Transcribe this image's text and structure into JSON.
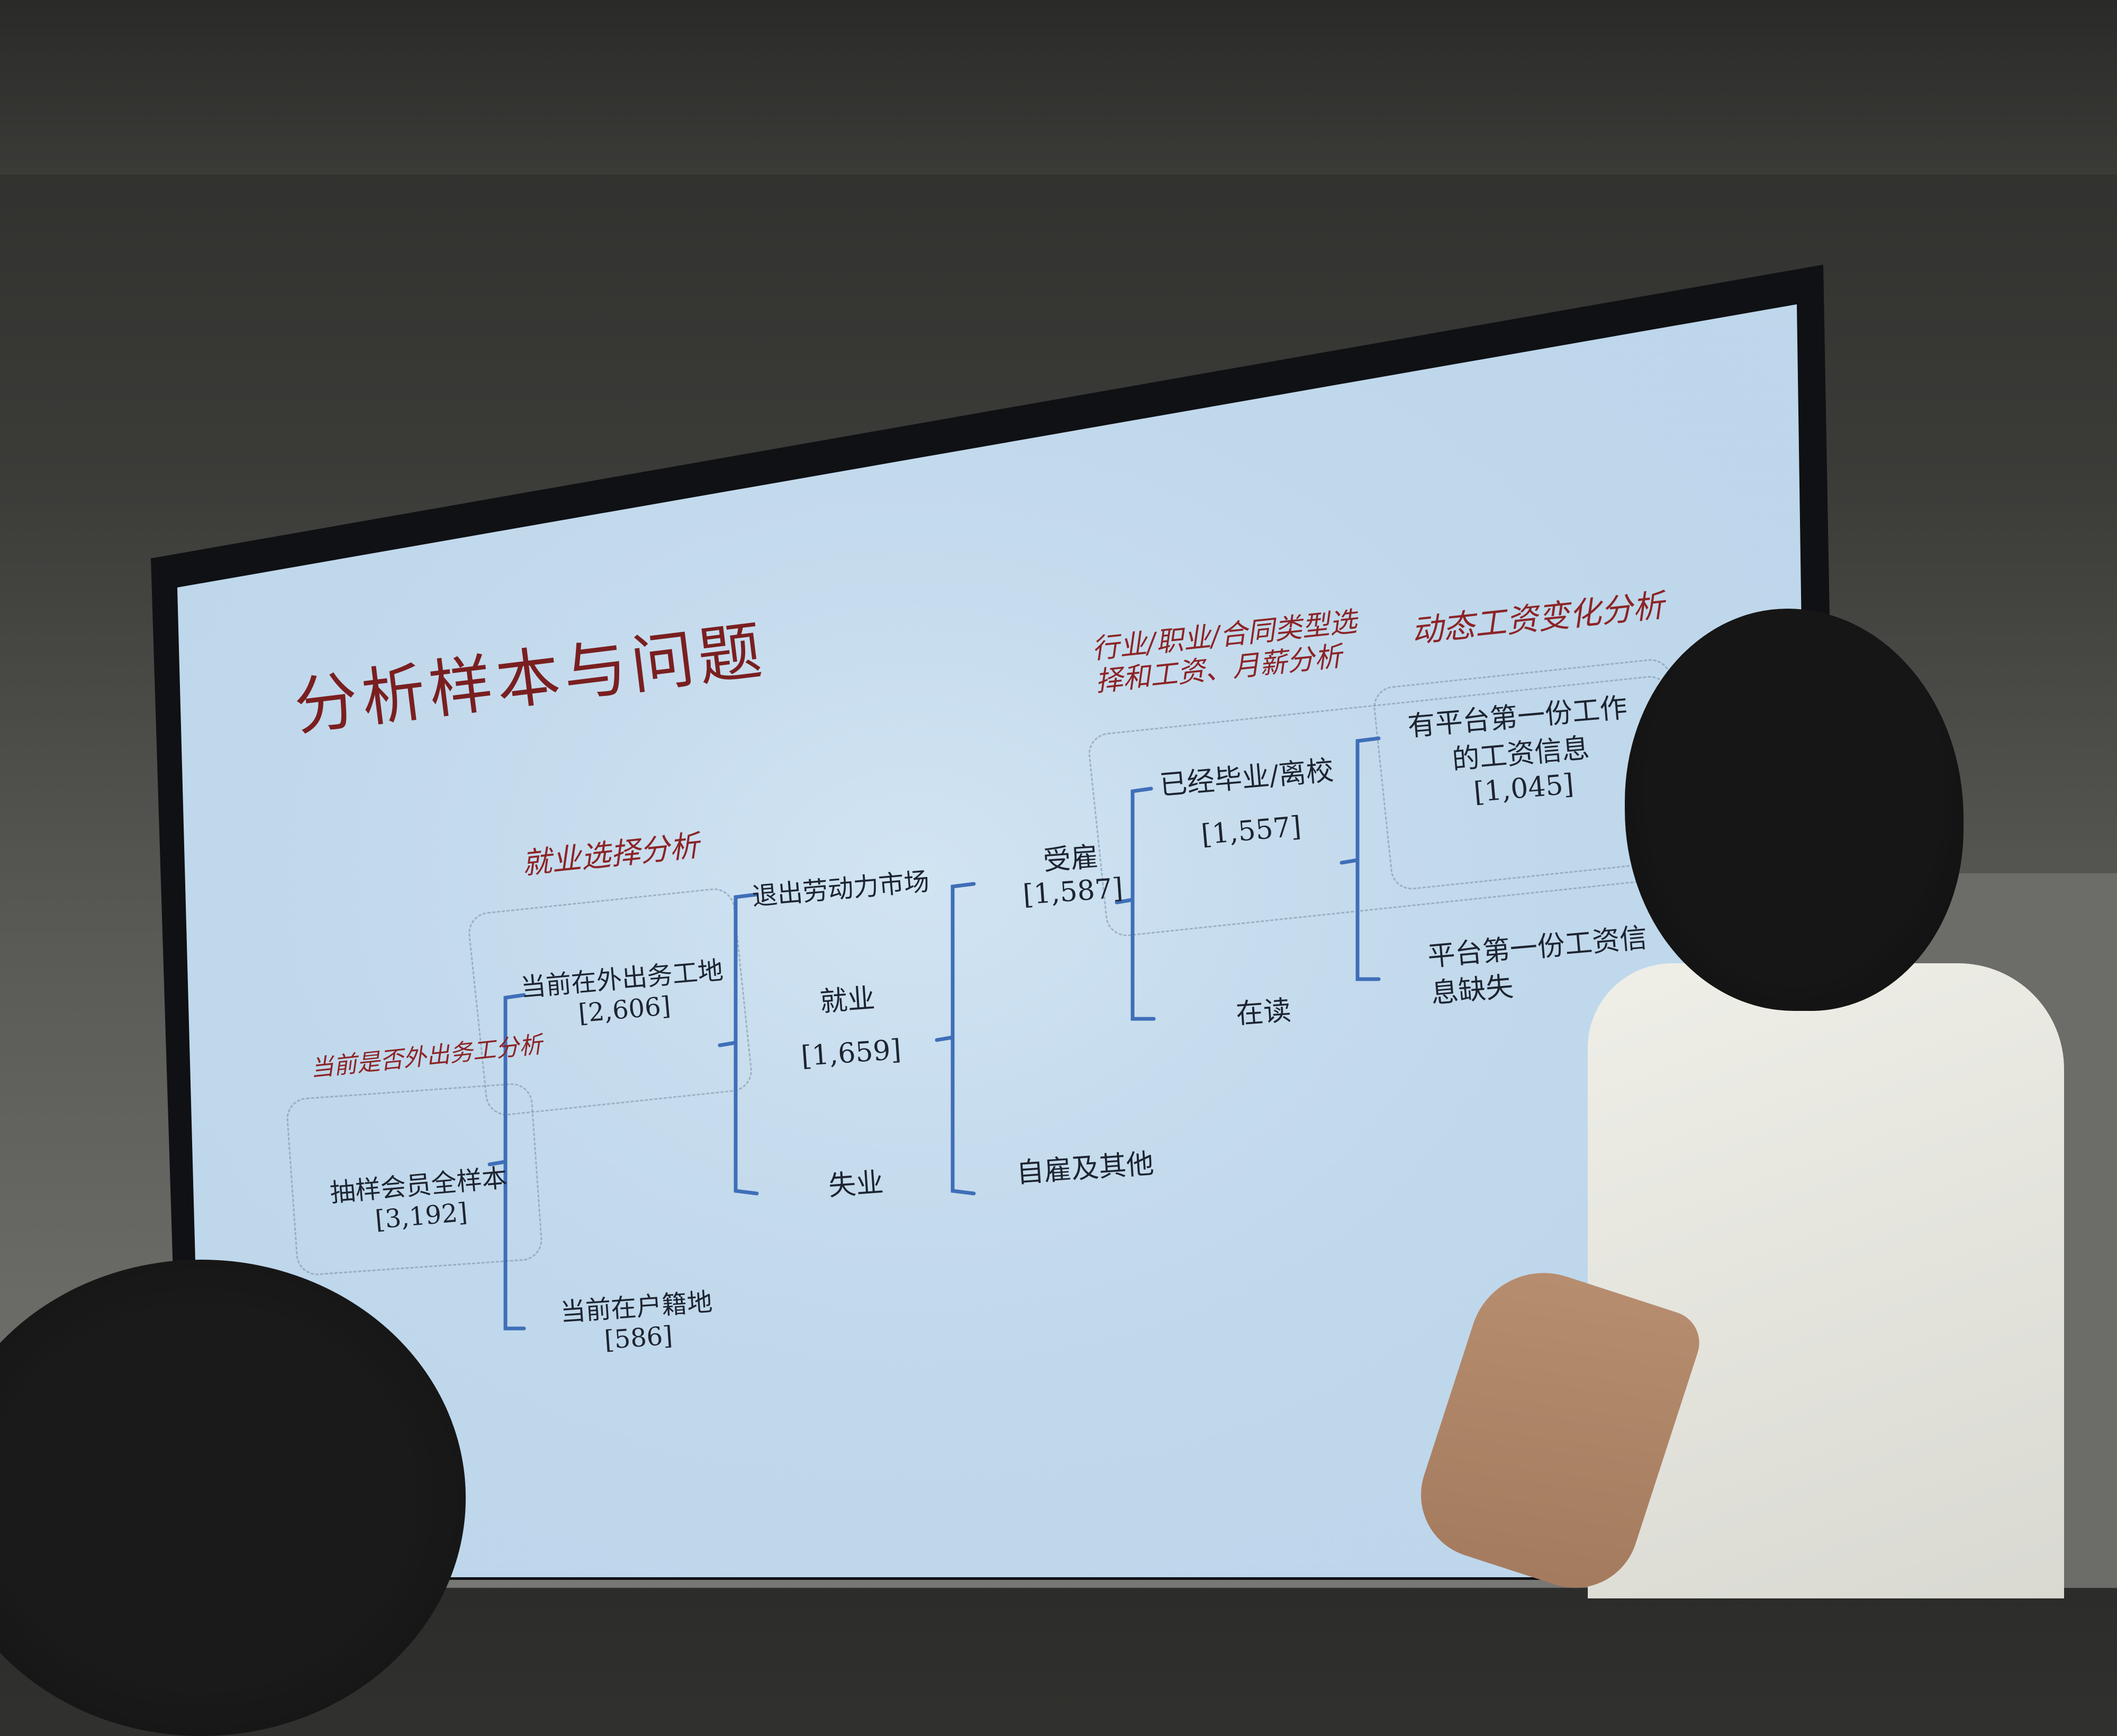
{
  "slide": {
    "title": "分析样本与问题",
    "section_labels": {
      "employment_choice": "就业选择分析",
      "migrant_work": "当前是否外出务工分析",
      "industry_occupation": "行业/职业/合同类型选\n择和工资、月薪分析",
      "dynamic_wage": "动态工资变化分析"
    },
    "nodes": {
      "full_sample": "抽样会员全样本",
      "full_sample_n": "[3,192]",
      "migrant": "当前在外出务工地",
      "migrant_n": "[2,606]",
      "hometown": "当前在户籍地",
      "hometown_n": "[586]",
      "exit_labor": "退出劳动力市场",
      "employed": "就业",
      "employed_n": "[1,659]",
      "unemployed": "失业",
      "hired": "受雇",
      "hired_n": "[1,587]",
      "self_employed": "自雇及其他",
      "graduated": "已经毕业/离校",
      "graduated_n": "[1,557]",
      "in_school": "在读",
      "has_wage": "有平台第一份工作\n的工资信息",
      "has_wage_n": "[1,045]",
      "missing_wage": "平台第一份工资信\n息缺失"
    }
  },
  "colors": {
    "screen_bg": "#bfd8ec",
    "bracket": "#3f6fb8",
    "accent_red": "#8c2426",
    "text_dark": "#1d2430"
  }
}
